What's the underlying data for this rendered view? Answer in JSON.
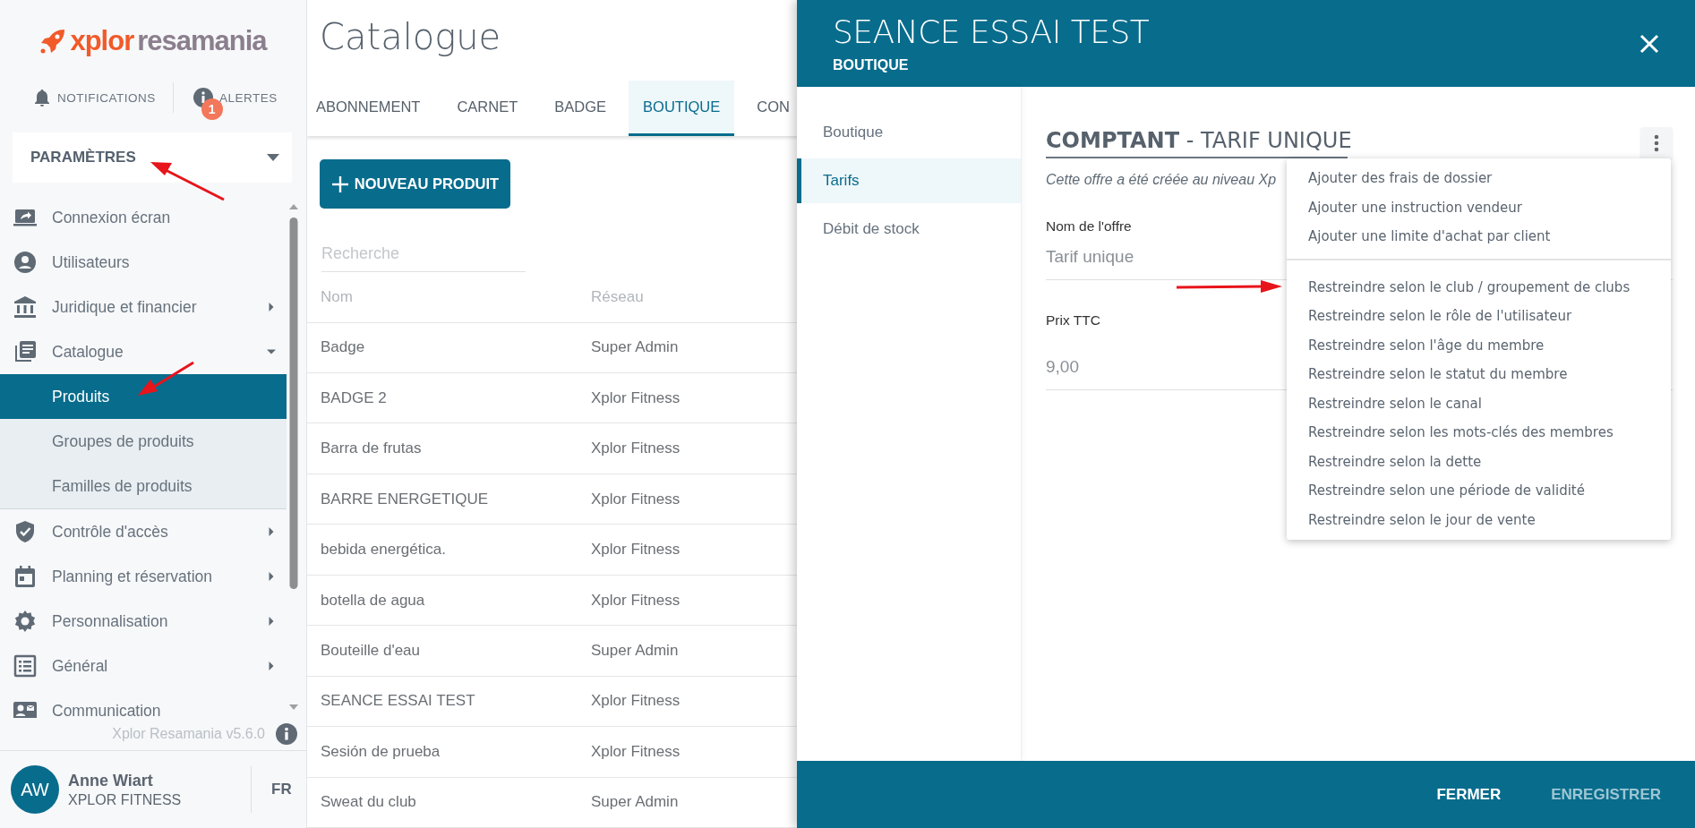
{
  "sidebar": {
    "logo": {
      "brand": "xplor",
      "product": "resamania"
    },
    "notifications": {
      "label": "NOTIFICATIONS"
    },
    "alerts": {
      "label": "ALERTES",
      "badge": "1"
    },
    "section": {
      "label": "PARAMÈTRES"
    },
    "items": [
      {
        "label": "Connexion écran",
        "kind": "link"
      },
      {
        "label": "Utilisateurs",
        "kind": "link"
      },
      {
        "label": "Juridique et financier",
        "kind": "group",
        "expanded": false
      },
      {
        "label": "Catalogue",
        "kind": "group",
        "expanded": true,
        "children": [
          {
            "label": "Produits",
            "selected": true
          },
          {
            "label": "Groupes de produits",
            "selected": false
          },
          {
            "label": "Familles de produits",
            "selected": false
          }
        ]
      },
      {
        "label": "Contrôle d'accès",
        "kind": "group",
        "expanded": false
      },
      {
        "label": "Planning et réservation",
        "kind": "group",
        "expanded": false
      },
      {
        "label": "Personnalisation",
        "kind": "group",
        "expanded": false
      },
      {
        "label": "Général",
        "kind": "group",
        "expanded": false
      },
      {
        "label": "Communication",
        "kind": "link"
      }
    ],
    "version": "Xplor Resamania v5.6.0",
    "user": {
      "initials": "AW",
      "name": "Anne Wiart",
      "company": "XPLOR FITNESS"
    },
    "language": "FR"
  },
  "main": {
    "title": "Catalogue",
    "tabs": [
      {
        "label": "ABONNEMENT",
        "selected": false
      },
      {
        "label": "CARNET",
        "selected": false
      },
      {
        "label": "BADGE",
        "selected": false
      },
      {
        "label": "BOUTIQUE",
        "selected": true
      },
      {
        "label": "CON",
        "selected": false
      }
    ],
    "new_button": "NOUVEAU PRODUIT",
    "search": {
      "placeholder": "Recherche"
    },
    "table": {
      "columns": [
        "Nom",
        "Réseau"
      ],
      "rows": [
        [
          "Badge",
          "Super Admin"
        ],
        [
          "BADGE 2",
          "Xplor Fitness"
        ],
        [
          "Barra de frutas",
          "Xplor Fitness"
        ],
        [
          "BARRE ENERGETIQUE",
          "Xplor Fitness"
        ],
        [
          "bebida energética.",
          "Xplor Fitness"
        ],
        [
          "botella de agua",
          "Xplor Fitness"
        ],
        [
          "Bouteille d'eau",
          "Super Admin"
        ],
        [
          "SEANCE ESSAI TEST",
          "Xplor Fitness"
        ],
        [
          "Sesión de prueba",
          "Xplor Fitness"
        ],
        [
          "Sweat du club",
          "Super Admin"
        ]
      ]
    }
  },
  "panel": {
    "title": "SEANCE ESSAI TEST",
    "subtitle": "BOUTIQUE",
    "nav": [
      {
        "label": "Boutique",
        "selected": false
      },
      {
        "label": "Tarifs",
        "selected": true
      },
      {
        "label": "Débit de stock",
        "selected": false
      }
    ],
    "heading": "**COMPTANT** - TARIF UNIQUE",
    "note": "Cette offre a été créée au niveau Xp",
    "fields": [
      {
        "label": "Nom de l'offre",
        "value": "Tarif unique"
      },
      {
        "label": "Prix TTC",
        "value": "9,00"
      }
    ],
    "menu": [
      [
        "Ajouter des frais de dossier",
        "Ajouter une instruction vendeur",
        "Ajouter une limite d'achat par client"
      ],
      [
        "Restreindre selon le club / groupement de clubs",
        "Restreindre selon le rôle de l'utilisateur",
        "Restreindre selon l'âge du membre",
        "Restreindre selon le statut du membre",
        "Restreindre selon le canal",
        "Restreindre selon les mots-clés des membres",
        "Restreindre selon la dette",
        "Restreindre selon une période de validité",
        "Restreindre selon le jour de vente"
      ]
    ],
    "footer": [
      {
        "label": "FERMER",
        "disabled": false
      },
      {
        "label": "ENREGISTRER",
        "disabled": true
      }
    ]
  }
}
